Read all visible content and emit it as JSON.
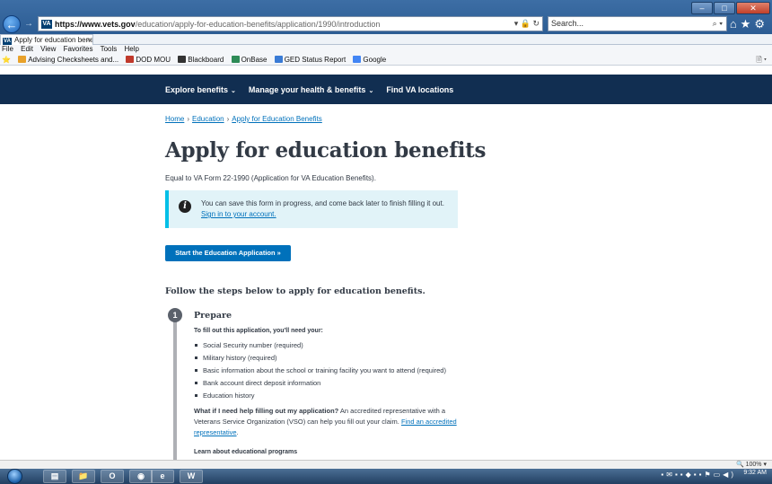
{
  "browser": {
    "url_host": "https://www.vets.gov",
    "url_path": "/education/apply-for-education-benefits/application/1990/introduction",
    "search_placeholder": "Search...",
    "tab_label": "Apply for education benefit...",
    "tab_close": "×",
    "menu": [
      "File",
      "Edit",
      "View",
      "Favorites",
      "Tools",
      "Help"
    ],
    "favorites": [
      {
        "label": "Advising Checksheets and...",
        "color": "#e8a12a"
      },
      {
        "label": "DOD MOU",
        "color": "#c0392b"
      },
      {
        "label": "Blackboard",
        "color": "#333333"
      },
      {
        "label": "OnBase",
        "color": "#2e8b57"
      },
      {
        "label": "GED Status Report",
        "color": "#3a7bd5"
      },
      {
        "label": "Google",
        "color": "#4285f4"
      }
    ],
    "zoom": "100%"
  },
  "va_nav": {
    "items": [
      "Explore benefits",
      "Manage your health & benefits",
      "Find VA locations"
    ]
  },
  "breadcrumb": {
    "items": [
      "Home",
      "Education",
      "Apply for Education Benefits"
    ],
    "separator": "›"
  },
  "page": {
    "title": "Apply for education benefits",
    "intro": "Equal to VA Form 22-1990 (Application for VA Education Benefits).",
    "alert_text": "You can save this form in progress, and come back later to finish filling it out.",
    "alert_link": "Sign in to your account.",
    "start_button": "Start the Education Application »",
    "steps_heading": "Follow the steps below to apply for education benefits.",
    "step1": {
      "number": "1",
      "title": "Prepare",
      "lead": "To fill out this application, you'll need your:",
      "items": [
        "Social Security number (required)",
        "Military history (required)",
        "Basic information about the school or training facility you want to attend (required)",
        "Bank account direct deposit information",
        "Education history"
      ],
      "help_question": "What if I need help filling out my application?",
      "help_text": " An accredited representative with a Veterans Service Organization (VSO) can help you fill out your claim. ",
      "help_link": "Find an accredited representative",
      "help_end": ".",
      "learn": "Learn about educational programs"
    }
  },
  "taskbar": {
    "clock_time": "9:32 AM"
  }
}
